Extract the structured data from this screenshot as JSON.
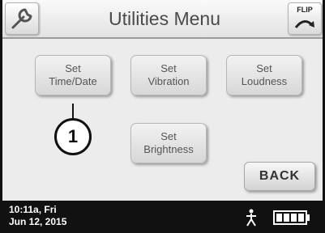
{
  "header": {
    "title": "Utilities Menu",
    "flip_label": "FLIP",
    "tool_icon": "wrench-icon",
    "flip_icon": "flip-arrow-icon"
  },
  "menu": {
    "set_time_date": [
      "Set",
      "Time/Date"
    ],
    "set_vibration": [
      "Set",
      "Vibration"
    ],
    "set_loudness": [
      "Set",
      "Loudness"
    ],
    "set_brightness": [
      "Set",
      "Brightness"
    ],
    "back": "BACK"
  },
  "callout": {
    "number": "1"
  },
  "status": {
    "time": "10:11a, Fri",
    "date": "Jun 12, 2015",
    "activity_icon": "person-icon",
    "battery_icon": "battery-icon"
  },
  "colors": {
    "status_bar": "#111111",
    "background": "#ececec",
    "button_text": "#555555"
  }
}
